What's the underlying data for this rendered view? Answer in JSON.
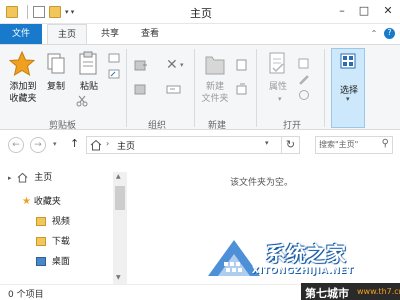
{
  "window": {
    "title": "主页",
    "qa_caret": "▾ ▾"
  },
  "tabs": [
    {
      "label": "文件"
    },
    {
      "label": "主页"
    },
    {
      "label": "共享"
    },
    {
      "label": "查看"
    }
  ],
  "ribbon": {
    "pin_label_1": "添加到",
    "pin_label_2": "收藏夹",
    "copy_label": "复制",
    "paste_label": "粘贴",
    "clipboard_group": "剪贴板",
    "organize_group": "组织",
    "new_folder_label_1": "新建",
    "new_folder_label_2": "文件夹",
    "new_group": "新建",
    "properties_label": "属性",
    "open_group": "打开",
    "select_label": "选择"
  },
  "address": {
    "path": "主页",
    "search_placeholder": "搜索\"主页\""
  },
  "nav_pane": {
    "items": [
      {
        "label": "主页"
      },
      {
        "label": "收藏夹"
      },
      {
        "label": "视频"
      },
      {
        "label": "下载"
      },
      {
        "label": "桌面"
      }
    ]
  },
  "content": {
    "empty_message": "该文件夹为空。"
  },
  "status": {
    "count": "0 个项目"
  },
  "watermark": {
    "main": "系统之家",
    "sub": "XITONGZHIJIA.NET",
    "badge_a": "第七城市",
    "badge_b": "www.th7.cn"
  },
  "colors": {
    "file_tab": "#1979ca",
    "ribbon_bg": "#f5f6f7",
    "folder": "#f1c75b",
    "star": "#f0a020",
    "select_highlight": "#cde8fb"
  }
}
